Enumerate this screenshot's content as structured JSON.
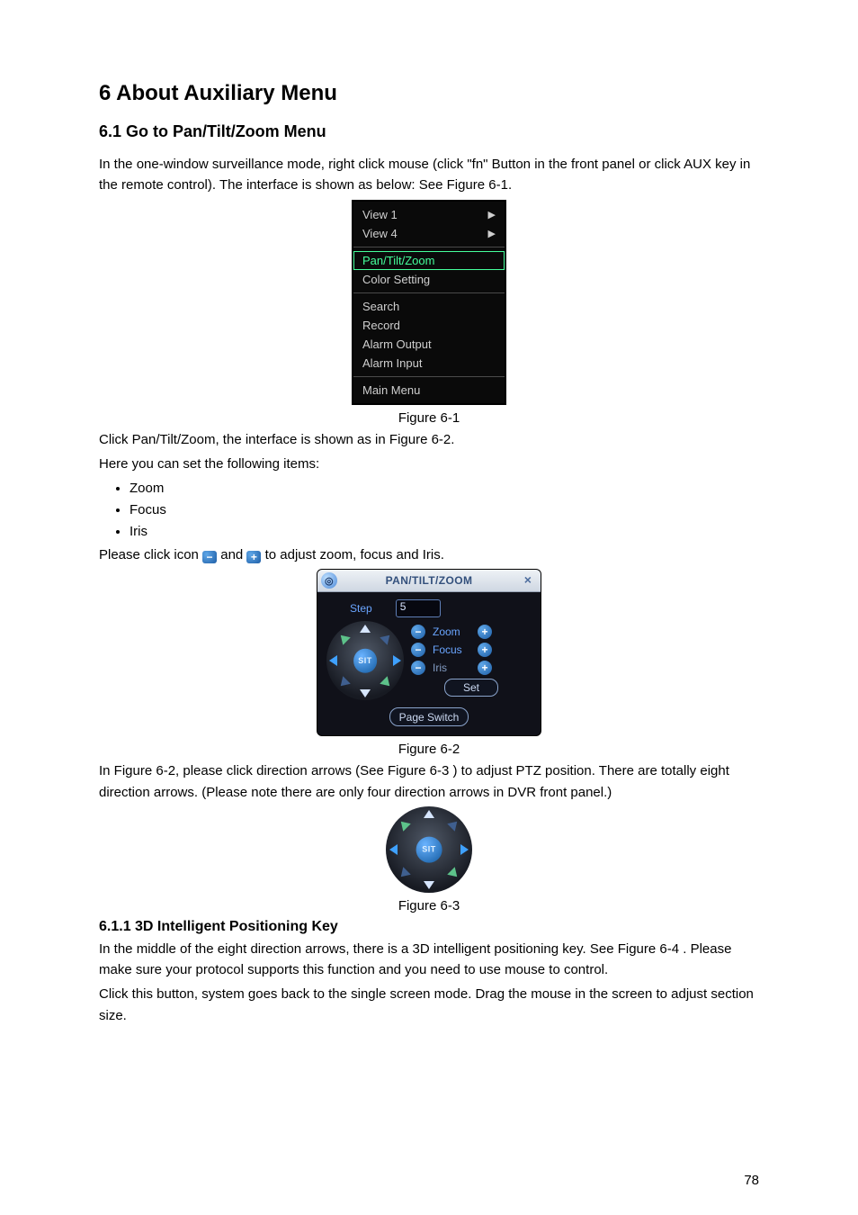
{
  "h1": "6  About Auxiliary Menu",
  "h2": "6.1    Go to Pan/Tilt/Zoom Menu",
  "p1": "In the one-window surveillance mode, right click mouse (click \"fn\" Button in the front panel or click AUX key in the remote control). The interface is shown as below: See Figure 6-1.",
  "context_menu": {
    "sections": [
      {
        "items": [
          "View 1",
          "View 4"
        ],
        "arrows": [
          true,
          true
        ]
      },
      {
        "items": [
          "Pan/Tilt/Zoom",
          "Color Setting"
        ],
        "highlightIndex": 0
      },
      {
        "items": [
          "Search",
          "Record",
          "Alarm Output",
          "Alarm Input"
        ]
      },
      {
        "items": [
          "Main Menu"
        ]
      }
    ]
  },
  "fig61": "Figure 6-1",
  "p2": "Click Pan/Tilt/Zoom, the interface is shown as in Figure 6-2.",
  "p3": "Here you can set the following items:",
  "bullets": [
    "Zoom",
    "Focus",
    "Iris"
  ],
  "p4_a": "Please click icon ",
  "p4_b": " and ",
  "p4_c": " to adjust zoom, focus and Iris.",
  "ptz": {
    "title": "PAN/TILT/ZOOM",
    "step_label": "Step",
    "step_value": "5",
    "rows": [
      {
        "label": "Zoom"
      },
      {
        "label": "Focus"
      },
      {
        "label": "Iris",
        "dim": true
      }
    ],
    "set_label": "Set",
    "sit_label": "SIT",
    "page_switch": "Page Switch"
  },
  "fig62": "Figure 6-2",
  "p5": "In Figure 6-2, please click direction arrows (See Figure 6-3 ) to adjust PTZ position. There are totally eight direction arrows. (Please note there are only four direction arrows in DVR front panel.)",
  "fig63": "Figure 6-3",
  "h3": "6.1.1  3D Intelligent Positioning Key",
  "p6": "In the middle of the eight direction arrows, there is a 3D intelligent positioning key. See Figure 6-4 . Please make sure your protocol supports this function and you need to use mouse to control.",
  "p7": "Click this button, system goes back to the single screen mode. Drag the mouse in the screen to adjust section size.",
  "page_number": "78"
}
